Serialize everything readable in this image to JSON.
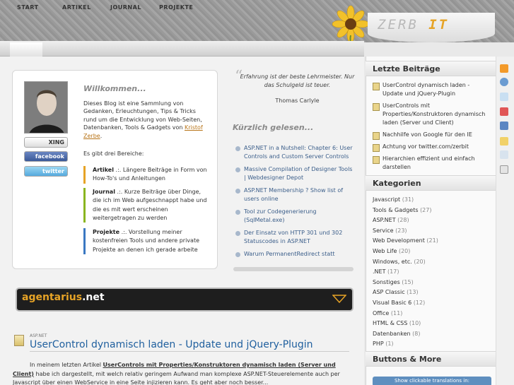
{
  "logo": {
    "text": "ZERB",
    "accent": "IT"
  },
  "nav": {
    "items": [
      "START",
      "ARTIKEL",
      "JOURNAL",
      "PROJEKTE"
    ]
  },
  "welcome": {
    "title": "Willkommen...",
    "text": "Dieses Blog ist eine Sammlung von Gedanken, Erleuchtungen, Tips & Tricks rund um die Entwicklung von Web-Seiten, Datenbanken, Tools & Gadgets von",
    "author_link": "Kristof Zerbe",
    "period": ".",
    "intro": "Es gibt drei Bereiche:",
    "areas": [
      {
        "name": "Artikel",
        "sep": " .:.",
        "desc": " Längere Beiträge in Form von How-To's und Anleitungen"
      },
      {
        "name": "Journal",
        "sep": " .:.",
        "desc": " Kurze Beiträge über Dinge, die ich im Web aufgeschnappt habe und die es mit wert erscheinen weitergetragen zu werden"
      },
      {
        "name": "Projekte",
        "sep": " .:.",
        "desc": " Vorstellung meiner kostenfreien Tools und andere private Projekte an denen ich gerade arbeite"
      }
    ]
  },
  "social": {
    "xing": "XING",
    "facebook": "facebook",
    "twitter": "twitter"
  },
  "quote": {
    "text": "Erfahrung ist der beste Lehrmeister. Nur das Schulgeld ist teuer.",
    "author": "Thomas Carlyle"
  },
  "recently_read": {
    "title": "Kürzlich gelesen...",
    "items": [
      "ASP.NET in a Nutshell: Chapter 6: User Controls and Custom Server Controls",
      "Massive Compilation of Designer Tools | Webdesigner Depot",
      "ASP.NET Membership ? Show list of users online",
      "Tool zur Codegenerierung (SqlMetal.exe)",
      "Der Einsatz von HTTP 301 und 302 Statuscodes in ASP.NET",
      "Warum PermanentRedirect statt"
    ]
  },
  "banner": {
    "name": "agentarius",
    "suffix": ".net"
  },
  "post": {
    "category": "ASP.NET",
    "title": "UserControl dynamisch laden - Update und jQuery-Plugin",
    "text_a": "In meinem letzten Artikel ",
    "text_link": "UserControls mit Properties/Konstruktoren dynamisch laden (Server und Client)",
    "text_b": " habe ich dargestellt, mit welch relativ geringem Aufwand man komplexe ASP.NET-Steuerelemente auch per Javascript über einen WebService in eine Seite injizieren kann. Es geht aber noch besser..."
  },
  "sidebar": {
    "recent_title": "Letzte Beiträge",
    "recent": [
      "UserControl dynamisch laden - Update und jQuery-Plugin",
      "UserControls mit Properties/Konstruktoren dynamisch laden (Server und Client)",
      "Nachhilfe von Google für den IE",
      "Achtung vor twitter.com/zerbit",
      "Hierarchien effizient und einfach darstellen"
    ],
    "categories_title": "Kategorien",
    "categories": [
      {
        "name": "Javascript",
        "count": "(31)"
      },
      {
        "name": "Tools & Gadgets",
        "count": "(27)"
      },
      {
        "name": "ASP.NET",
        "count": "(28)"
      },
      {
        "name": "Service",
        "count": "(23)"
      },
      {
        "name": "Web Development",
        "count": "(21)"
      },
      {
        "name": "Web Life",
        "count": "(20)"
      },
      {
        "name": "Windows, etc.",
        "count": "(20)"
      },
      {
        "name": ".NET",
        "count": "(17)"
      },
      {
        "name": "Sonstiges",
        "count": "(15)"
      },
      {
        "name": "ASP Classic",
        "count": "(13)"
      },
      {
        "name": "Visual Basic 6",
        "count": "(12)"
      },
      {
        "name": "Office",
        "count": "(11)"
      },
      {
        "name": "HTML & CSS",
        "count": "(10)"
      },
      {
        "name": "Datenbanken",
        "count": "(8)"
      },
      {
        "name": "PHP",
        "count": "(1)"
      }
    ],
    "buttons_title": "Buttons & More",
    "translate_button": "Show clickable translations in:"
  },
  "colors": {
    "accent": "#e6a326",
    "link": "#1f5f9e",
    "green": "#8ab520",
    "blue": "#3b78c2"
  },
  "side_icons": [
    "rss-icon",
    "search-icon",
    "comments-icon",
    "calendar-icon",
    "mail-icon",
    "tag-icon",
    "stats-icon",
    "legal-icon"
  ]
}
